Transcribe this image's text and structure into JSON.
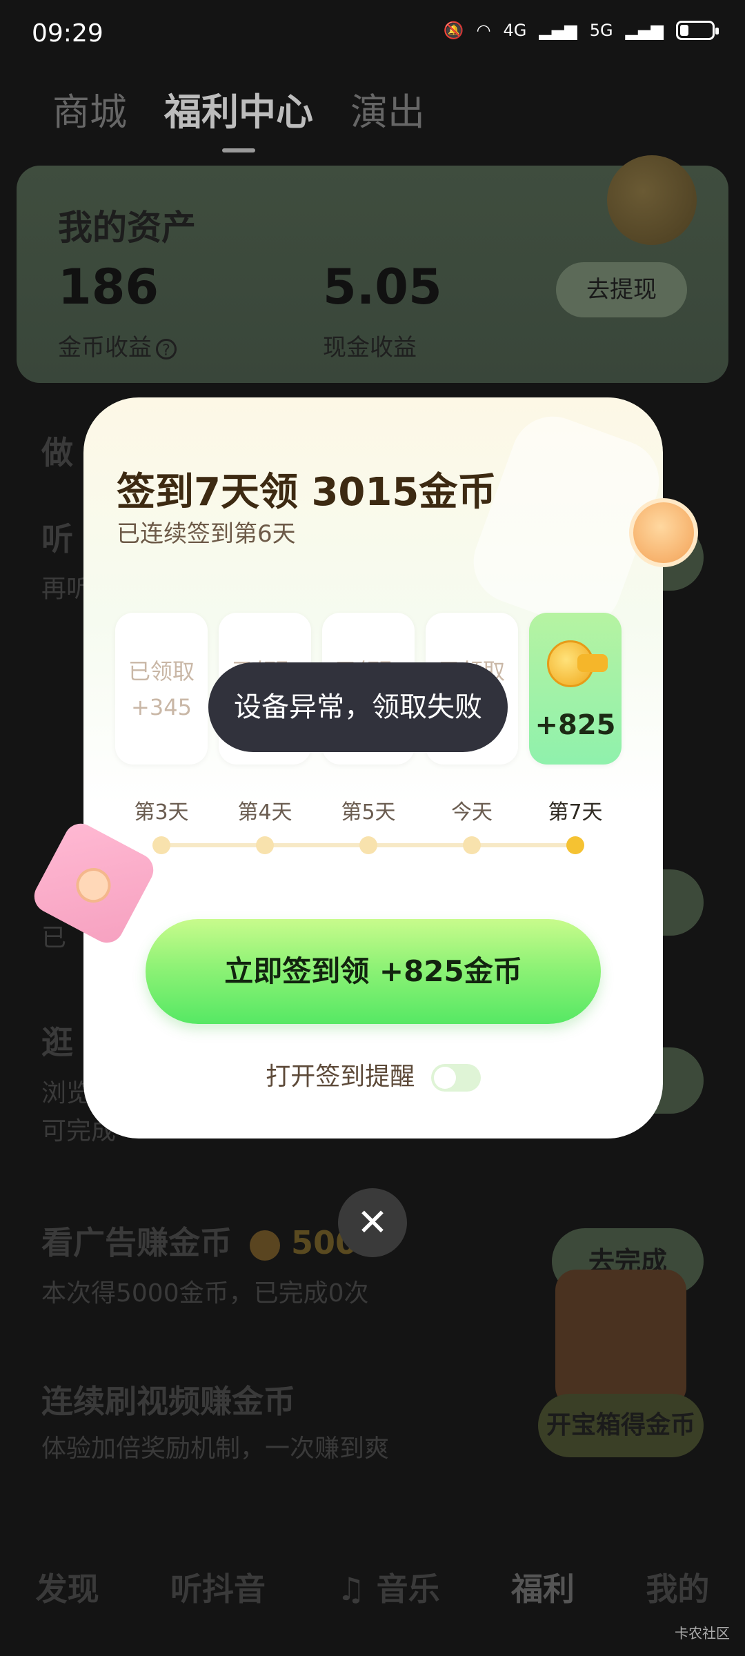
{
  "status_bar": {
    "time": "09:29",
    "net1": "4G",
    "net2": "5G"
  },
  "top_tabs": [
    "商城",
    "福利中心",
    "演出"
  ],
  "assets": {
    "title": "我的资产",
    "coin_value": "186",
    "coin_label": "金币收益",
    "cash_value": "5.05",
    "cash_label": "现金收益",
    "withdraw_label": "去提现"
  },
  "background_tasks": {
    "section_title_partial": "做",
    "listen_partial": "听",
    "listen_sub_partial": "再听",
    "browse_partial": "逛",
    "browse_sub1_partial": "浏览",
    "browse_sub2_partial": "可完成",
    "misc_partial": "已",
    "ad_title": "看广告赚金币",
    "ad_reward": "500",
    "ad_sub": "本次得5000金币，已完成0次",
    "ad_button": "去完成",
    "video_title": "连续刷视频赚金币",
    "video_sub": "体验加倍奖励机制，一次赚到爽",
    "chest_label": "开宝箱得金币"
  },
  "bottom_nav": [
    "发现",
    "听抖音",
    "音乐",
    "福利",
    "我的"
  ],
  "modal": {
    "headline_prefix": "签到7天领 ",
    "headline_amount": "3015金币",
    "subtitle": "已连续签到第6天",
    "days": [
      {
        "label": "第3天",
        "status": "已领取",
        "points": "+345"
      },
      {
        "label": "第4天",
        "status": "已领取",
        "points": ""
      },
      {
        "label": "第5天",
        "status": "已领取",
        "points": ""
      },
      {
        "label": "今天",
        "status": "已领取",
        "points": ""
      },
      {
        "label": "第7天",
        "status": "",
        "points": "+825"
      }
    ],
    "cta_label": "立即签到领 +825金币",
    "reminder_label": "打开签到提醒",
    "reminder_enabled": false
  },
  "toast": "设备异常，领取失败",
  "close_symbol": "✕",
  "watermark": "卡农社区"
}
